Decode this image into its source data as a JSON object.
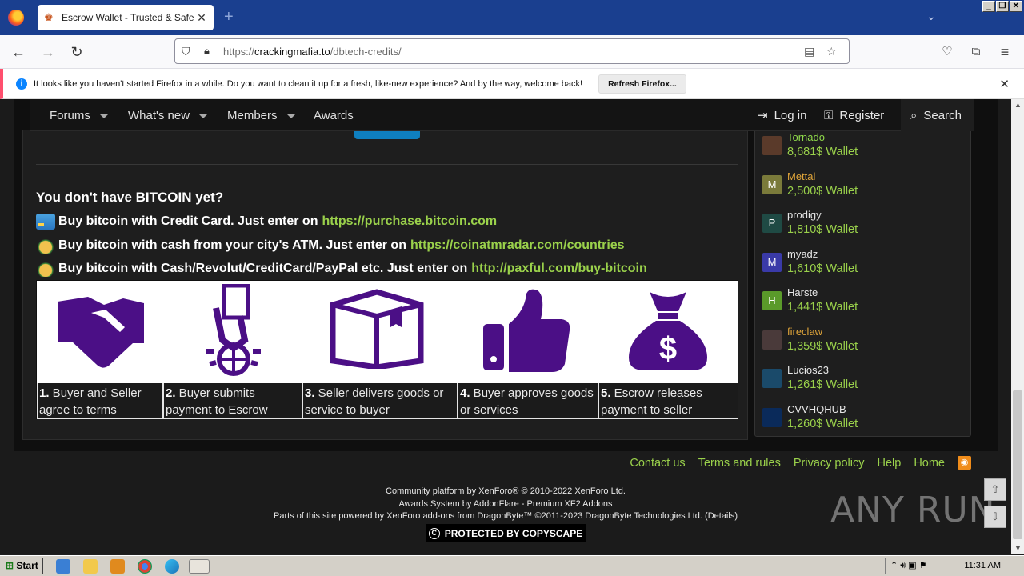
{
  "browser": {
    "tab_title": "Escrow Wallet - Trusted & Safe tra",
    "url_prefix": "https://",
    "url_host": "crackingmafia.to",
    "url_path": "/dbtech-credits/",
    "notification": "It looks like you haven't started Firefox in a while. Do you want to clean it up for a fresh, like-new experience? And by the way, welcome back!",
    "refresh_label": "Refresh Firefox..."
  },
  "nav": {
    "forums": "Forums",
    "whats_new": "What's new",
    "members": "Members",
    "awards": "Awards",
    "login": "Log in",
    "register": "Register",
    "search": "Search"
  },
  "main": {
    "heading": "You don't have BITCOIN yet?",
    "buy_lines": [
      {
        "text": "Buy bitcoin with Credit Card. Just enter on",
        "link": "https://purchase.bitcoin.com"
      },
      {
        "text": "Buy bitcoin with cash from your city's ATM. Just enter on",
        "link": "https://coinatmradar.com/countries"
      },
      {
        "text": "Buy bitcoin with Cash/Revolut/CreditCard/PayPal etc. Just enter on",
        "link": "http://paxful.com/buy-bitcoin"
      }
    ],
    "steps": [
      {
        "num": "1.",
        "text": " Buyer and Seller agree to terms"
      },
      {
        "num": "2.",
        "text": " Buyer submits payment to Escrow"
      },
      {
        "num": "3.",
        "text": " Seller delivers goods or service to buyer"
      },
      {
        "num": "4.",
        "text": " Buyer approves goods or services"
      },
      {
        "num": "5.",
        "text": " Escrow releases payment to seller"
      }
    ]
  },
  "sidebar": {
    "wallet_suffix": " Wallet",
    "users": [
      {
        "name": "Tornado",
        "value": "8,681$",
        "name_color": "#8fd94a",
        "avatar": "",
        "avatar_color": "#5a3a2a"
      },
      {
        "name": "Mettal",
        "value": "2,500$",
        "name_color": "#e0a53a",
        "avatar": "M",
        "avatar_color": "#7a7a3a"
      },
      {
        "name": "prodigy",
        "value": "1,810$",
        "name_color": "#e6e6e6",
        "avatar": "P",
        "avatar_color": "#1f4a44"
      },
      {
        "name": "myadz",
        "value": "1,610$",
        "name_color": "#e6e6e6",
        "avatar": "M",
        "avatar_color": "#3a3aa8"
      },
      {
        "name": "Harste",
        "value": "1,441$",
        "name_color": "#e6e6e6",
        "avatar": "H",
        "avatar_color": "#5a9a2a"
      },
      {
        "name": "fireclaw",
        "value": "1,359$",
        "name_color": "#e0a53a",
        "avatar": "",
        "avatar_color": "#4a3a3a"
      },
      {
        "name": "Lucios23",
        "value": "1,261$",
        "name_color": "#e6e6e6",
        "avatar": "",
        "avatar_color": "#1a4a6a"
      },
      {
        "name": "CVVHQHUB",
        "value": "1,260$",
        "name_color": "#e6e6e6",
        "avatar": "",
        "avatar_color": "#0a2a5a"
      }
    ]
  },
  "footer": {
    "links": [
      "Contact us",
      "Terms and rules",
      "Privacy policy",
      "Help",
      "Home"
    ],
    "line1": "Community platform by XenForo® © 2010-2022 XenForo Ltd.",
    "line2": "Awards System by AddonFlare - Premium XF2 Addons",
    "line3": "Parts of this site powered by XenForo add-ons from DragonByte™ ©2011-2023 DragonByte Technologies Ltd. (Details)",
    "copyscape": "PROTECTED BY COPYSCAPE"
  },
  "watermark": "ANY RUN",
  "taskbar": {
    "start": "Start",
    "clock": "11:31 AM"
  },
  "colors": {
    "accent_green": "#9ad14b",
    "icon_purple": "#4b0f86",
    "titlebar_blue": "#1a3f8f"
  }
}
